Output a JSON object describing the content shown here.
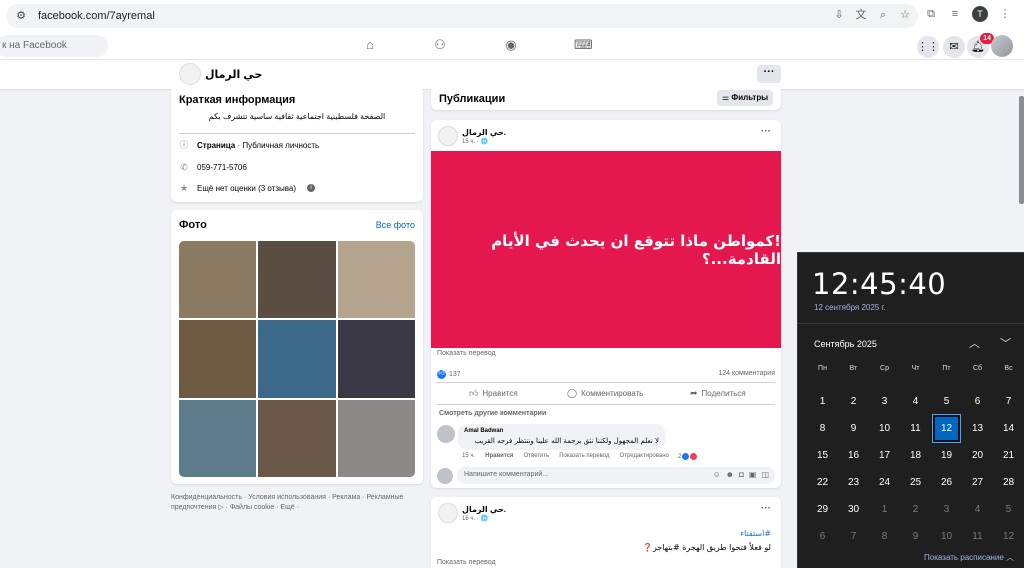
{
  "browser": {
    "url": "facebook.com/7ayremal"
  },
  "fb_nav": {
    "search_placeholder": "к на Facebook",
    "notification_count": "14"
  },
  "page": {
    "name": "حي الرمال"
  },
  "intro": {
    "title": "Краткая информация",
    "bio": "الصفحة فلسطينية اجتماعية ثقافية ساسية تتشرف بكم",
    "category_bold": "Страница",
    "category_rest": " · Публичная личность",
    "phone": "059-771-5706",
    "rating": "Ещё нет оценки (3 отзыва)"
  },
  "photos": {
    "title": "Фото",
    "see_all": "Все фото",
    "tiles": [
      "#8a7a62",
      "#5a4e42",
      "#b5a58f",
      "#6e5a40",
      "#3d6a8a",
      "#3a3845",
      "#5d7c8c",
      "#6a5848",
      "#8c8a86"
    ]
  },
  "footer": {
    "links": "Конфиденциальность · Условия использования · Реклама · Рекламные предпочтения ▷ · Файлы cookie · Ещё ·"
  },
  "feed": {
    "title": "Публикации",
    "filters_label": "Фильтры"
  },
  "post1": {
    "author": "حي الرمال.",
    "time": "15 ч. · 🌐",
    "image_text": "!كمواطن ماذا تتوقع ان يحدث في الأيام القادمة...؟",
    "image_color": "#e4174e",
    "translate": "Показать перевод",
    "likes": "137",
    "comments": "124 комментария",
    "like_label": "Нравится",
    "comment_label": "Комментировать",
    "share_label": "Поделиться",
    "more_comments": "Смотреть другие комментарии",
    "comment_author": "Amal Badwan",
    "comment_text": "لا نعلم المجهول ولكننا نثق برحمة الله علينا وننتظر فرجه القريب",
    "comment_time": "15 ч.",
    "comment_like": "Нравится",
    "comment_reply": "Ответить",
    "comment_translate": "Показать перевод",
    "comment_edited": "Отредактировано",
    "comment_reactions": "2",
    "write_placeholder": "Напишите комментарий..."
  },
  "post2": {
    "author": "حي الرمال.",
    "time": "16 ч. · 🌐",
    "tag": "#استفتاء",
    "text": "لو فعلاً فتحوا طريق الهجرة #بتهاجر❓",
    "translate": "Показать перевод"
  },
  "clock": {
    "time": "12:45:40",
    "date": "12 сентября 2025 г.",
    "month": "Сентябрь 2025",
    "weekdays": [
      "Пн",
      "Вт",
      "Ср",
      "Чт",
      "Пт",
      "Сб",
      "Вс"
    ],
    "days": [
      "1",
      "2",
      "3",
      "4",
      "5",
      "6",
      "7",
      "8",
      "9",
      "10",
      "11",
      "12",
      "13",
      "14",
      "15",
      "16",
      "17",
      "18",
      "19",
      "20",
      "21",
      "22",
      "23",
      "24",
      "25",
      "26",
      "27",
      "28",
      "29",
      "30",
      "1",
      "2",
      "3",
      "4",
      "5",
      "6",
      "7",
      "8",
      "9",
      "10",
      "11",
      "12"
    ],
    "today": "12",
    "agenda": "Показать расписание"
  }
}
